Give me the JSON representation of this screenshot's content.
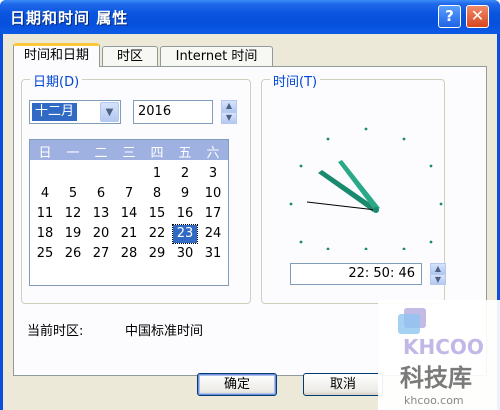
{
  "window": {
    "title": "日期和时间 属性",
    "help_glyph": "?",
    "close_glyph": "✕"
  },
  "tabs": [
    {
      "label": "时间和日期",
      "active": true
    },
    {
      "label": "时区",
      "active": false
    },
    {
      "label": "Internet 时间",
      "active": false
    }
  ],
  "date_group": {
    "title": "日期(D)",
    "month": "十二月",
    "year": "2016",
    "weekdays": [
      "日",
      "一",
      "二",
      "三",
      "四",
      "五",
      "六"
    ],
    "weeks": [
      [
        "",
        "",
        "",
        "",
        "1",
        "2",
        "3"
      ],
      [
        "4",
        "5",
        "6",
        "7",
        "8",
        "9",
        "10"
      ],
      [
        "11",
        "12",
        "13",
        "14",
        "15",
        "16",
        "17"
      ],
      [
        "18",
        "19",
        "20",
        "21",
        "22",
        "23",
        "24"
      ],
      [
        "25",
        "26",
        "27",
        "28",
        "29",
        "30",
        "31"
      ]
    ],
    "selected_day": "23"
  },
  "time_group": {
    "title": "时间(T)",
    "time": "22: 50: 46"
  },
  "timezone": {
    "label": "当前时区:",
    "value": "中国标准时间"
  },
  "buttons": {
    "ok": "确定",
    "cancel": "取消"
  },
  "watermark": {
    "logo": "KHCOO",
    "name": "科技库",
    "url": "khcoo.com"
  },
  "colors": {
    "titlebar": "#0a55e0",
    "selection": "#316ac5",
    "group_title": "#0046d5",
    "clock_hands": "#1a8a6e"
  },
  "icons": {
    "dropdown": "chevron-down-icon",
    "spin_up": "arrow-up-icon",
    "spin_down": "arrow-down-icon",
    "help": "help-icon",
    "close": "close-icon"
  }
}
